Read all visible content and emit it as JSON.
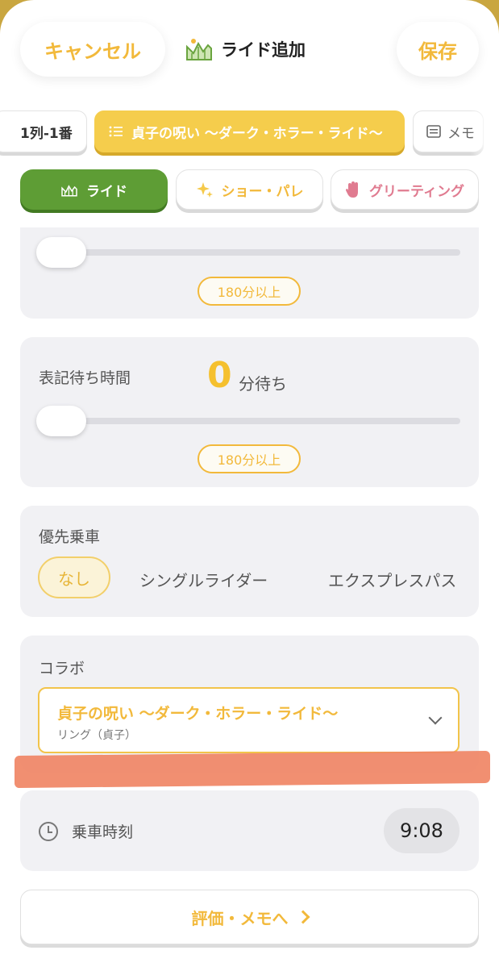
{
  "header": {
    "cancel_label": "キャンセル",
    "title": "ライド追加",
    "save_label": "保存"
  },
  "ride_chips": {
    "left": "1列-1番",
    "selected": "貞子の呪い 〜ダーク・ホラー・ライド〜",
    "right": "メモ"
  },
  "categories": {
    "ride": "ライド",
    "show": "ショー・パレ",
    "greeting": "グリーティング"
  },
  "slider_top": {
    "value": 0,
    "max_label": "180分以上"
  },
  "posted_wait": {
    "label": "表記待ち時間",
    "value": "0",
    "unit": "分待ち",
    "max_label": "180分以上"
  },
  "priority": {
    "label": "優先乗車",
    "options": [
      "なし",
      "シングルライダー",
      "エクスプレスパス"
    ],
    "selected": "なし"
  },
  "collab": {
    "label": "コラボ",
    "title": "貞子の呪い 〜ダーク・ホラー・ライド〜",
    "subtitle": "リング（貞子）"
  },
  "ride_time": {
    "label": "乗車時刻",
    "value": "9:08"
  },
  "memo_button": {
    "label": "評価・メモへ"
  },
  "colors": {
    "accent": "#f2b93b",
    "ride_green": "#5e9d35",
    "greeting_pink": "#e07b90",
    "highlight": "#f08565"
  },
  "icons": {
    "title": "ride-graph-icon",
    "list": "list-icon",
    "memo": "memo-icon",
    "show": "sparkle-icon",
    "greeting": "wave-hand-icon",
    "time": "clock-icon"
  }
}
